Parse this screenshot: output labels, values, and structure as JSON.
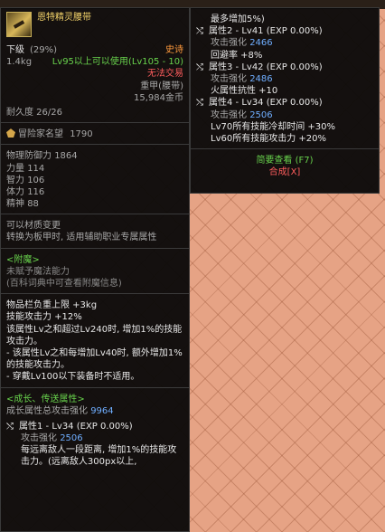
{
  "item": {
    "name": "恩特精灵腰带",
    "grade": "下级",
    "grade_pct": "(29%)",
    "rarity": "史诗",
    "weight": "1.4kg",
    "level_req": "Lv95以上可以使用(Lv105 - 10)",
    "trade": "无法交易",
    "armor_type": "重甲(腰带)",
    "price": "15,984金币",
    "durability": "耐久度 26/26"
  },
  "fame": {
    "label": "冒险家名望",
    "value": "1790"
  },
  "stats": [
    {
      "label": "物理防御力",
      "value": "1864"
    },
    {
      "label": "力量",
      "value": "114"
    },
    {
      "label": "智力",
      "value": "106"
    },
    {
      "label": "体力",
      "value": "116"
    },
    {
      "label": "精神",
      "value": "88"
    }
  ],
  "material": {
    "line1": "可以材质变更",
    "line2": "转换为板甲时, 适用辅助职业专属属性"
  },
  "enchant": {
    "header": "<附魔>",
    "line1": "未赋予魔法能力",
    "line2": "(百科词典中可查看附魔信息)"
  },
  "options": {
    "lines": [
      "物品栏负重上限 +3kg",
      "技能攻击力 +12%",
      "该属性Lv之和超过Lv240时, 增加1%的技能攻击力。",
      "- 该属性Lv之和每增加Lv40时, 额外增加1%的技能攻击力。",
      "- 穿戴Lv100以下装备时不适用。"
    ]
  },
  "growth": {
    "header": "<成长、传送属性>",
    "total_label": "成长属性总攻击强化",
    "total_value": "9964",
    "attr1_title": "属性1 - Lv34 (EXP 0.00%)",
    "attr1_atk_label": "攻击强化",
    "attr1_atk_value": "2506",
    "attr1_desc": "每远离敌人一段距离, 增加1%的技能攻击力。(远离敌人300px以上,"
  },
  "side": {
    "top_line": "最多增加5%)",
    "attr2_title": "属性2 - Lv41 (EXP 0.00%)",
    "attr2_atk_label": "攻击强化",
    "attr2_atk_value": "2466",
    "attr2_extra": "回避率 +8%",
    "attr3_title": "属性3 - Lv42 (EXP 0.00%)",
    "attr3_atk_label": "攻击强化",
    "attr3_atk_value": "2486",
    "attr3_extra": "火属性抗性 +10",
    "attr4_title": "属性4 - Lv34 (EXP 0.00%)",
    "attr4_atk_label": "攻击强化",
    "attr4_atk_value": "2506",
    "attr4_extra1": "Lv70所有技能冷却时间 +30%",
    "attr4_extra2": "Lv60所有技能攻击力 +20%",
    "brief_view": "简要查看 (F7)",
    "synth": "合成[X]"
  },
  "colors": {
    "rarity_orange": "#ff9a3c",
    "gold_name": "#f3d36a",
    "enchant_green": "#68d24c",
    "value_blue": "#6faeff",
    "warn_red": "#ff5d5d"
  }
}
